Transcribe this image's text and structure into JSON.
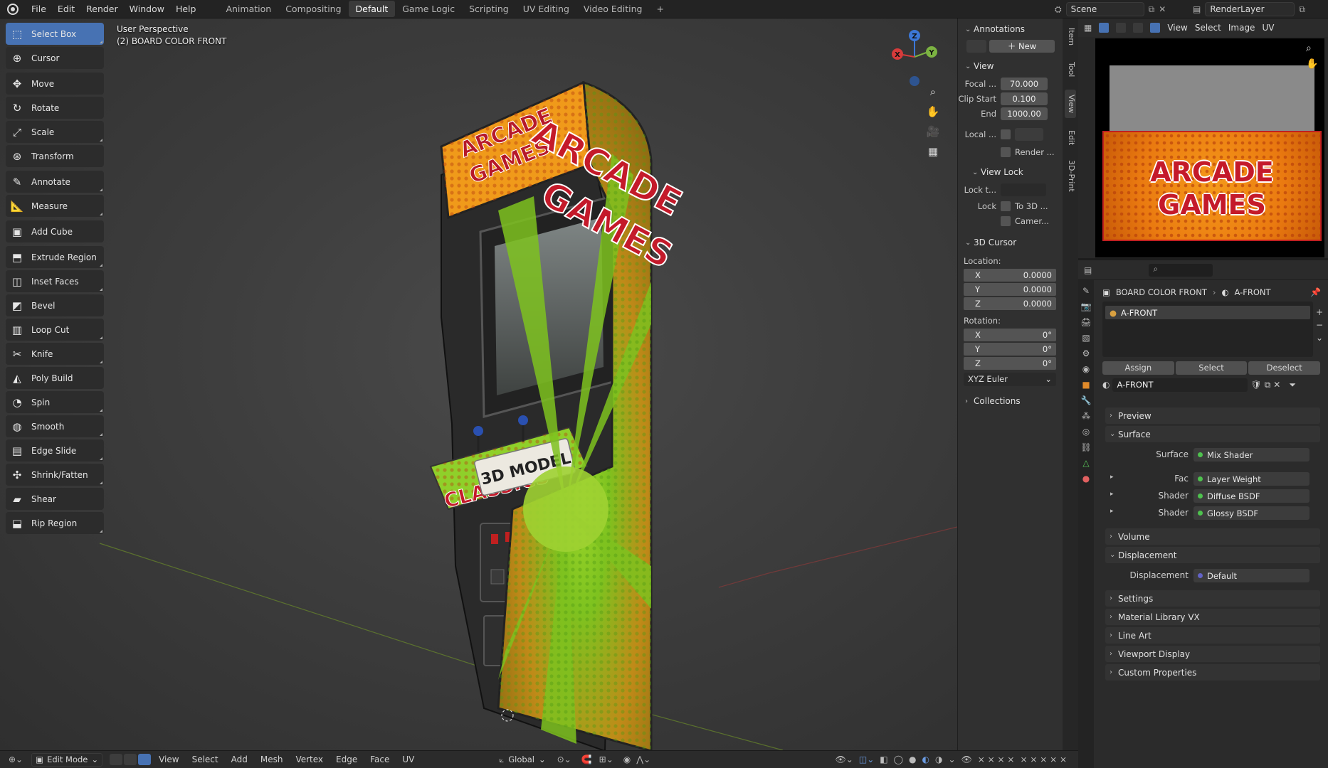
{
  "menu": [
    "File",
    "Edit",
    "Render",
    "Window",
    "Help"
  ],
  "workspaces": [
    "Animation",
    "Compositing",
    "Default",
    "Game Logic",
    "Scripting",
    "UV Editing",
    "Video Editing"
  ],
  "active_workspace": "Default",
  "scene": "Scene",
  "render_layer": "RenderLayer",
  "viewport": {
    "perspective": "User Perspective",
    "object": "(2) BOARD COLOR FRONT",
    "gizmo": {
      "x": "X",
      "y": "Y",
      "z": "Z"
    }
  },
  "tools": [
    {
      "label": "Select Box",
      "icon": "select-box-icon",
      "glyph": "⬚"
    },
    {
      "label": "Cursor",
      "icon": "cursor-icon",
      "glyph": "⊕"
    },
    {
      "label": "Move",
      "icon": "move-icon",
      "glyph": "✥"
    },
    {
      "label": "Rotate",
      "icon": "rotate-icon",
      "glyph": "↻"
    },
    {
      "label": "Scale",
      "icon": "scale-icon",
      "glyph": "⤢"
    },
    {
      "label": "Transform",
      "icon": "transform-icon",
      "glyph": "⊛"
    },
    {
      "label": "Annotate",
      "icon": "annotate-icon",
      "glyph": "✎"
    },
    {
      "label": "Measure",
      "icon": "measure-icon",
      "glyph": "📐"
    },
    {
      "label": "Add Cube",
      "icon": "add-cube-icon",
      "glyph": "▣"
    },
    {
      "label": "Extrude Region",
      "icon": "extrude-icon",
      "glyph": "⬒"
    },
    {
      "label": "Inset Faces",
      "icon": "inset-icon",
      "glyph": "◫"
    },
    {
      "label": "Bevel",
      "icon": "bevel-icon",
      "glyph": "◩"
    },
    {
      "label": "Loop Cut",
      "icon": "loop-cut-icon",
      "glyph": "▥"
    },
    {
      "label": "Knife",
      "icon": "knife-icon",
      "glyph": "✂"
    },
    {
      "label": "Poly Build",
      "icon": "poly-build-icon",
      "glyph": "◭"
    },
    {
      "label": "Spin",
      "icon": "spin-icon",
      "glyph": "◔"
    },
    {
      "label": "Smooth",
      "icon": "smooth-icon",
      "glyph": "◍"
    },
    {
      "label": "Edge Slide",
      "icon": "edge-slide-icon",
      "glyph": "▤"
    },
    {
      "label": "Shrink/Fatten",
      "icon": "shrink-icon",
      "glyph": "✣"
    },
    {
      "label": "Shear",
      "icon": "shear-icon",
      "glyph": "▰"
    },
    {
      "label": "Rip Region",
      "icon": "rip-icon",
      "glyph": "⬓"
    }
  ],
  "npanel": {
    "annotations": "Annotations",
    "new_btn": "New",
    "view": "View",
    "focal_label": "Focal ...",
    "focal_value": "70.000",
    "clip_start_label": "Clip Start",
    "clip_start_value": "0.100",
    "end_label": "End",
    "end_value": "1000.00",
    "local_label": "Local ...",
    "render_label": "Render ...",
    "view_lock": "View Lock",
    "lock_to_label": "Lock t...",
    "lock_label": "Lock",
    "to_3d": "To 3D ...",
    "camera": "Camer...",
    "cursor_3d": "3D Cursor",
    "location": "Location:",
    "loc": [
      {
        "axis": "X",
        "v": "0.0000"
      },
      {
        "axis": "Y",
        "v": "0.0000"
      },
      {
        "axis": "Z",
        "v": "0.0000"
      }
    ],
    "rotation": "Rotation:",
    "rot": [
      {
        "axis": "X",
        "v": "0°"
      },
      {
        "axis": "Y",
        "v": "0°"
      },
      {
        "axis": "Z",
        "v": "0°"
      }
    ],
    "euler": "XYZ Euler",
    "collections": "Collections"
  },
  "vtabs": [
    "Item",
    "Tool",
    "View",
    "Edit",
    "3D-Print"
  ],
  "image_editor": {
    "menu": [
      "View",
      "Select",
      "Image",
      "UV"
    ],
    "texture_text": [
      "ARCADE",
      "GAMES"
    ]
  },
  "properties": {
    "breadcrumb_obj": "BOARD COLOR FRONT",
    "breadcrumb_mat": "A-FRONT",
    "slot": "A-FRONT",
    "assign": "Assign",
    "select": "Select",
    "deselect": "Deselect",
    "material_name": "A-FRONT",
    "sections": [
      "Preview",
      "Surface",
      "Volume",
      "Displacement",
      "Settings",
      "Material Library VX",
      "Line Art",
      "Viewport Display",
      "Custom Properties"
    ],
    "surface_label": "Surface",
    "surface_value": "Mix Shader",
    "fac_label": "Fac",
    "fac_value": "Layer Weight",
    "shader1_label": "Shader",
    "shader1_value": "Diffuse BSDF",
    "shader2_label": "Shader",
    "shader2_value": "Glossy BSDF",
    "disp_label": "Displacement",
    "disp_value": "Default"
  },
  "bottombar": {
    "mode": "Edit Mode",
    "menu": [
      "View",
      "Select",
      "Add",
      "Mesh",
      "Vertex",
      "Edge",
      "Face",
      "UV"
    ],
    "orientation": "Global"
  },
  "scene_text": {
    "top_marquee": [
      "ARCADE",
      "GAMES"
    ],
    "side": [
      "ARCADE",
      "GAMES"
    ],
    "control_panel": "CLASSICS",
    "sign": "3D MODEL"
  },
  "colors": {
    "accent": "#4772b3",
    "orange": "#f08a1c",
    "green": "#7ecb22",
    "red": "#c8202a"
  }
}
